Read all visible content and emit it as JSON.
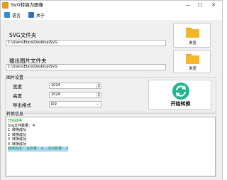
{
  "window": {
    "title": "SVG转换为图像",
    "minimize_glyph": "—",
    "maximize_glyph": "☐",
    "close_glyph": "✕"
  },
  "menu": {
    "language": "语言",
    "about": "关于"
  },
  "svg_folder": {
    "label": "SVG文件夹",
    "path": "C:\\Users\\Eters\\Desktop\\SVG",
    "browse_label": "浏览"
  },
  "output_folder": {
    "label": "输出图片文件夹",
    "path": "C:\\Users\\Eters\\Desktop\\SVG",
    "browse_label": "浏览"
  },
  "settings": {
    "group_title": "图片设置",
    "width_label": "宽度",
    "width_value": "1024",
    "height_label": "高度",
    "height_value": "1024",
    "format_label": "导出格式",
    "format_value": "jpg"
  },
  "convert_button": {
    "label": "开始转换"
  },
  "log": {
    "group_title": "转换信息",
    "lines": [
      "开始转换",
      "Svg文件数量: 4",
      "1 转换成功",
      "2 转换成功",
      "3 转换成功",
      "4 转换成功",
      "转换完成! 总数量: 4, 成功数量: 4"
    ]
  },
  "colors": {
    "folder": "#f3b72b",
    "convert_icon": "#23b58e",
    "log_green": "#1a8f22",
    "selection": "#a8d6ff"
  },
  "icons": {
    "app": "app-icon",
    "language": "language-icon",
    "about": "about-icon",
    "folder": "folder-icon",
    "convert": "refresh-arrows-icon"
  }
}
